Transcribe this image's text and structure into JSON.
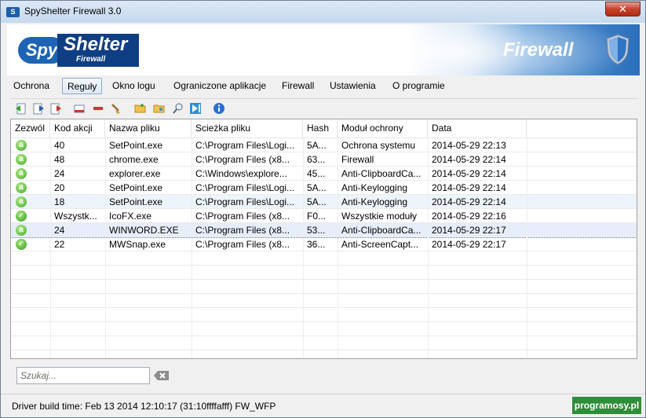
{
  "window": {
    "title": "SpyShelter Firewall 3.0",
    "app_icon_text": "S",
    "close_glyph": "✕"
  },
  "banner": {
    "logo_spy": "Spy",
    "logo_shelter": "Shelter",
    "logo_sub": "Firewall",
    "title": "Firewall"
  },
  "menu": {
    "items": [
      "Ochrona",
      "Reguły",
      "Okno logu",
      "Ograniczone aplikacje",
      "Firewall",
      "Ustawienia",
      "O programie"
    ],
    "active": "Reguły"
  },
  "toolbar": {
    "icons": [
      "import-rules-icon",
      "export-rules-icon",
      "export-selected-icon",
      "select-none-icon",
      "delete-icon",
      "clean-icon",
      "add-folder-icon",
      "open-folder-icon",
      "find-icon",
      "jump-icon",
      "info-icon"
    ]
  },
  "table": {
    "columns": [
      "Zezwól",
      "Kod akcji",
      "Nazwa pliku",
      "Scieżka pliku",
      "Hash",
      "Moduł ochrony",
      "Data"
    ],
    "rows": [
      {
        "icon": "a",
        "code": "40",
        "file": "SetPoint.exe",
        "path": "C:\\Program Files\\Logi...",
        "hash": "5A...",
        "module": "Ochrona systemu",
        "date": "2014-05-29 22:13"
      },
      {
        "icon": "a",
        "code": "48",
        "file": "chrome.exe",
        "path": "C:\\Program Files (x8...",
        "hash": "63...",
        "module": "Firewall",
        "date": "2014-05-29 22:14"
      },
      {
        "icon": "a",
        "code": "24",
        "file": "explorer.exe",
        "path": "C:\\Windows\\explore...",
        "hash": "45...",
        "module": "Anti-ClipboardCa...",
        "date": "2014-05-29 22:14"
      },
      {
        "icon": "a",
        "code": "20",
        "file": "SetPoint.exe",
        "path": "C:\\Program Files\\Logi...",
        "hash": "5A...",
        "module": "Anti-Keylogging",
        "date": "2014-05-29 22:14"
      },
      {
        "icon": "a",
        "code": "18",
        "file": "SetPoint.exe",
        "path": "C:\\Program Files\\Logi...",
        "hash": "5A...",
        "module": "Anti-Keylogging",
        "date": "2014-05-29 22:14"
      },
      {
        "icon": "check",
        "code": "Wszystk...",
        "file": "IcoFX.exe",
        "path": "C:\\Program Files (x8...",
        "hash": "F0...",
        "module": "Wszystkie moduły",
        "date": "2014-05-29 22:16"
      },
      {
        "icon": "a",
        "code": "24",
        "file": "WINWORD.EXE",
        "path": "C:\\Program Files (x8...",
        "hash": "53...",
        "module": "Anti-ClipboardCa...",
        "date": "2014-05-29 22:17"
      },
      {
        "icon": "check",
        "code": "22",
        "file": "MWSnap.exe",
        "path": "C:\\Program Files (x8...",
        "hash": "36...",
        "module": "Anti-ScreenCapt...",
        "date": "2014-05-29 22:17"
      }
    ],
    "selected_row": 6
  },
  "search": {
    "placeholder": "Szukaj..."
  },
  "status": {
    "text": "Driver build time: Feb 13 2014 12:10:17  (31:10ffffafff) FW_WFP",
    "watermark": "programosy.pl"
  },
  "colors": {
    "accent": "#2a6fbc",
    "allow_green": "#3fa82a",
    "watermark_green": "#2f8d3a"
  }
}
